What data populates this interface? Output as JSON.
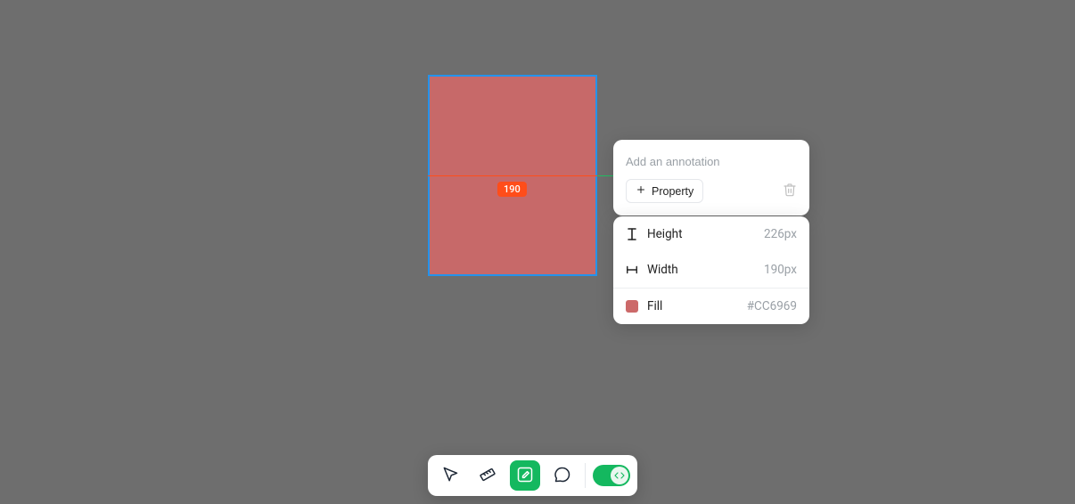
{
  "shape": {
    "dimension_label": "190"
  },
  "annotation": {
    "placeholder": "Add an annotation",
    "value": "",
    "property_button_label": "Property"
  },
  "properties": {
    "height": {
      "label": "Height",
      "value": "226px"
    },
    "width": {
      "label": "Width",
      "value": "190px"
    },
    "fill": {
      "label": "Fill",
      "value": "#CC6969"
    }
  },
  "toolbar": {
    "tools": {
      "cursor": "cursor",
      "ruler": "ruler",
      "edit": "edit",
      "comment": "comment"
    },
    "code_toggle": "code"
  }
}
